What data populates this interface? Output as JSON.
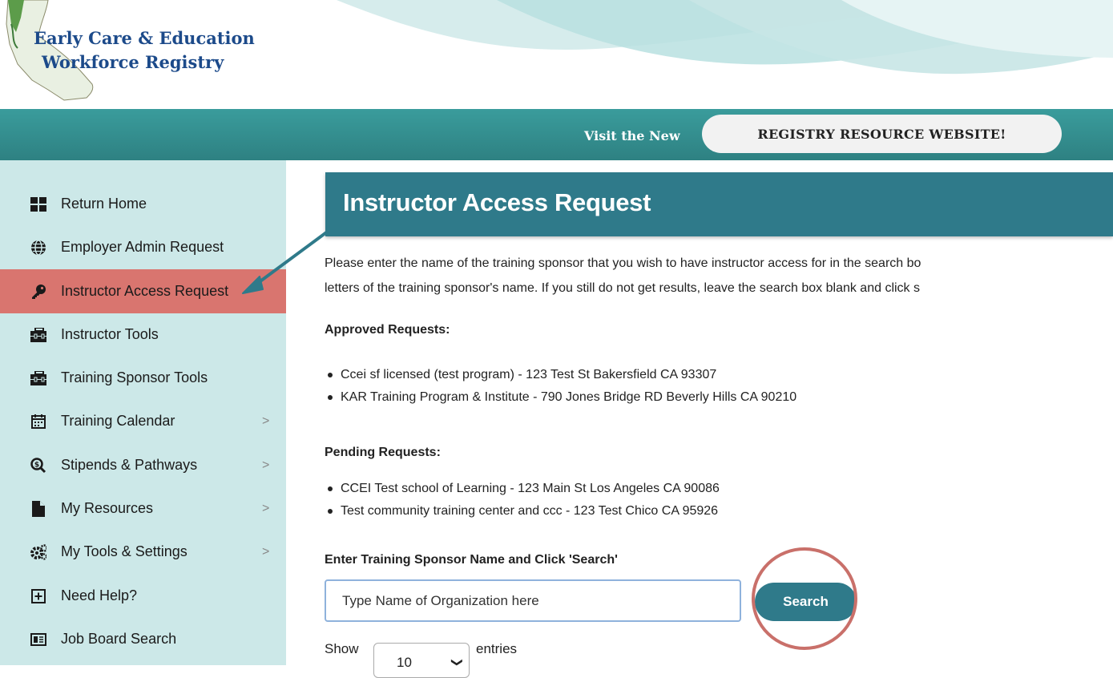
{
  "header": {
    "logo_line1": "Early Care & Education",
    "logo_line2": "Workforce Registry"
  },
  "banner": {
    "visit_label": "Visit the New",
    "resource_button": "REGISTRY RESOURCE WEBSITE!"
  },
  "sidebar": {
    "items": [
      {
        "label": "Return Home",
        "icon": "grid-icon"
      },
      {
        "label": "Employer Admin Request",
        "icon": "globe-icon"
      },
      {
        "label": "Instructor Access Request",
        "icon": "key-icon",
        "active": true
      },
      {
        "label": "Instructor Tools",
        "icon": "toolbox-icon"
      },
      {
        "label": "Training Sponsor Tools",
        "icon": "toolbox-icon"
      },
      {
        "label": "Training Calendar",
        "icon": "calendar-icon",
        "chevron": ">"
      },
      {
        "label": "Stipends & Pathways",
        "icon": "search-dollar-icon",
        "chevron": ">"
      },
      {
        "label": "My Resources",
        "icon": "file-icon",
        "chevron": ">"
      },
      {
        "label": "My Tools & Settings",
        "icon": "cogs-icon",
        "chevron": ">"
      },
      {
        "label": "Need Help?",
        "icon": "plus-square-icon"
      },
      {
        "label": "Job Board Search",
        "icon": "id-card-icon"
      }
    ]
  },
  "main": {
    "title": "Instructor Access Request",
    "intro_line1": "Please enter the name of the training sponsor that you wish to have instructor access for in the search bo",
    "intro_line2": "letters of the training sponsor's name. If you still do not get results, leave the search box blank and click s",
    "approved_heading": "Approved Requests:",
    "approved": [
      "Ccei sf licensed (test program) - 123 Test St Bakersfield CA 93307",
      "KAR Training Program & Institute - 790 Jones Bridge RD Beverly Hills CA 90210"
    ],
    "pending_heading": "Pending Requests:",
    "pending": [
      "CCEI Test school of Learning - 123 Main St Los Angeles CA 90086",
      "Test community training center and ccc - 123 Test Chico CA 95926"
    ],
    "search_label": "Enter Training Sponsor Name and Click 'Search'",
    "search_placeholder": "Type Name of Organization here",
    "search_button": "Search",
    "show_label": "Show",
    "entries_value": "10",
    "entries_label": "entries"
  },
  "colors": {
    "teal_banner": "#2e8182",
    "title_bar": "#2f7a8a",
    "sidebar_bg": "#cce8e8",
    "active_item": "#d9756f",
    "annotation": "#c9706a"
  }
}
